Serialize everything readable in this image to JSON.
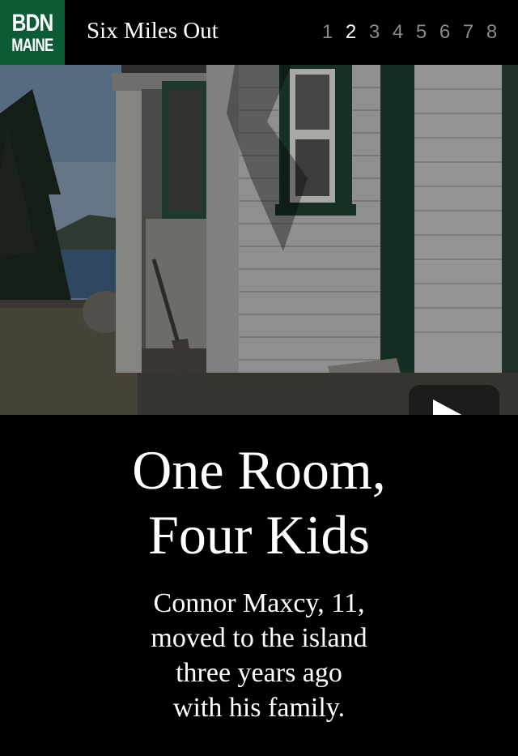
{
  "header": {
    "logo_line1": "BDN",
    "logo_line2": "MAINE",
    "series_title": "Six Miles Out",
    "pages": [
      "1",
      "2",
      "3",
      "4",
      "5",
      "6",
      "7",
      "8"
    ],
    "active_page": "2"
  },
  "hero": {
    "play_icon": "play-icon"
  },
  "story": {
    "title_lines": [
      "One Room,",
      "Four Kids"
    ],
    "subtitle_lines": [
      "Connor Maxcy, 11,",
      "moved to the island",
      "three years ago",
      "with his family."
    ]
  },
  "colors": {
    "brand": "#0d5b34",
    "background": "#000000",
    "pager_inactive": "#8a8a8a"
  }
}
